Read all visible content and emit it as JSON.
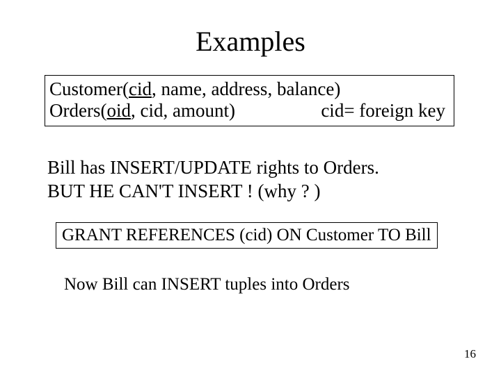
{
  "title": "Examples",
  "schema": {
    "line1_prefix": "Customer(",
    "line1_pk": "cid",
    "line1_rest": ", name, address, balance)",
    "line2_prefix": "Orders(",
    "line2_pk": "oid",
    "line2_rest": ", cid, amount)",
    "line2_note": "cid= foreign key"
  },
  "para1_l1": "Bill has INSERT/UPDATE rights to Orders.",
  "para1_l2": "BUT HE CAN'T INSERT ! (why ? )",
  "grant_stmt": "GRANT REFERENCES (cid)  ON Customer TO Bill",
  "para2": "Now Bill can INSERT tuples into Orders",
  "page_number": "16"
}
